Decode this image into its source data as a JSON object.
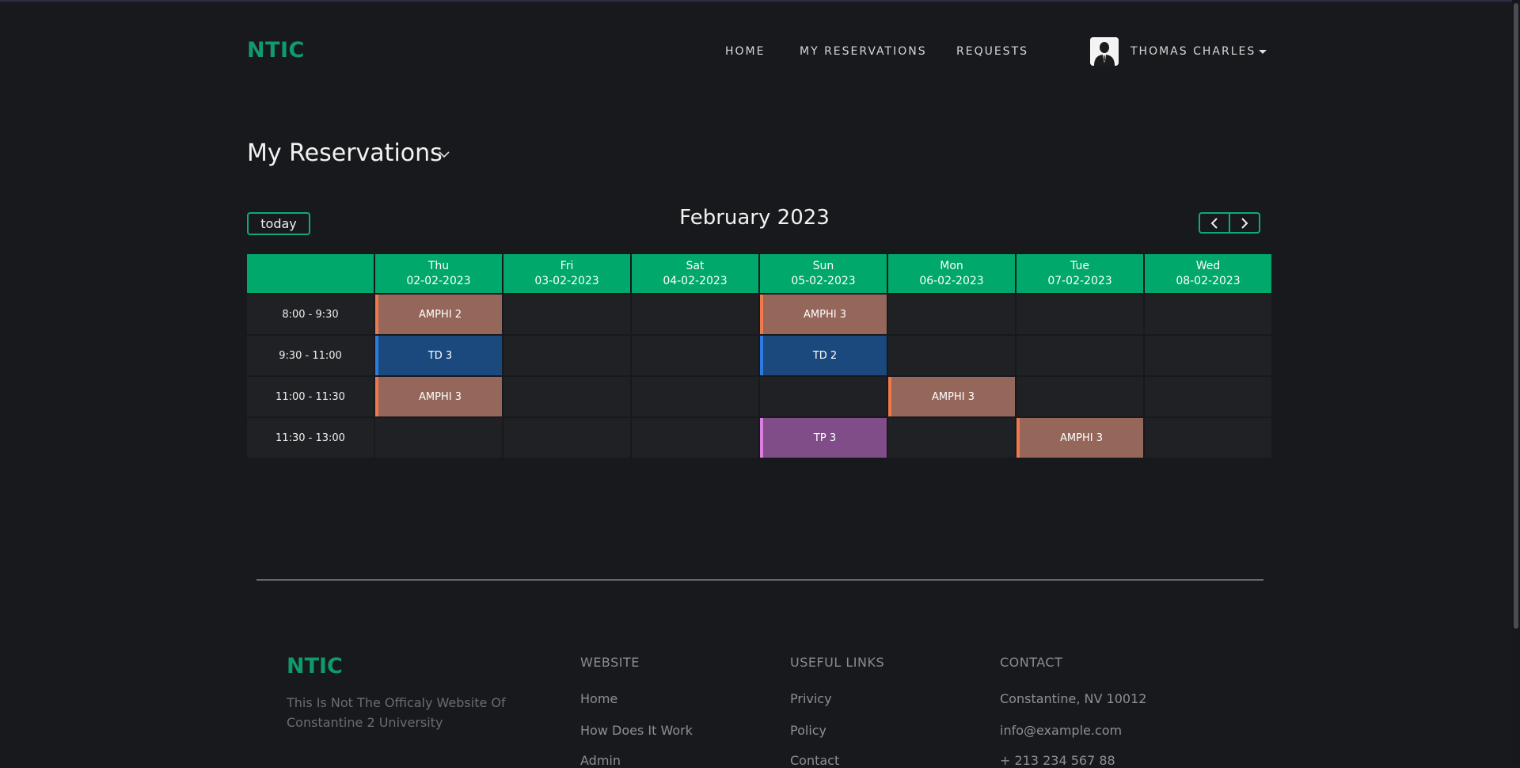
{
  "header": {
    "logo": "NTIC",
    "nav": [
      "HOME",
      "MY RESERVATIONS",
      "REQUESTS"
    ],
    "user_name": "THOMAS CHARLES"
  },
  "page": {
    "title": "My Reservations"
  },
  "calendar": {
    "today_label": "today",
    "month_title": "February 2023",
    "days": [
      {
        "name": "Thu",
        "date": "02-02-2023"
      },
      {
        "name": "Fri",
        "date": "03-02-2023"
      },
      {
        "name": "Sat",
        "date": "04-02-2023"
      },
      {
        "name": "Sun",
        "date": "05-02-2023"
      },
      {
        "name": "Mon",
        "date": "06-02-2023"
      },
      {
        "name": "Tue",
        "date": "07-02-2023"
      },
      {
        "name": "Wed",
        "date": "08-02-2023"
      }
    ],
    "slots": [
      "8:00 - 9:30",
      "9:30 - 11:00",
      "11:00 - 11:30",
      "11:30 - 13:00"
    ],
    "events": [
      {
        "day": 0,
        "slot": 0,
        "label": "AMPHI 2",
        "kind": "amphi"
      },
      {
        "day": 3,
        "slot": 0,
        "label": "AMPHI 3",
        "kind": "amphi"
      },
      {
        "day": 0,
        "slot": 1,
        "label": "TD 3",
        "kind": "td"
      },
      {
        "day": 3,
        "slot": 1,
        "label": "TD 2",
        "kind": "td"
      },
      {
        "day": 0,
        "slot": 2,
        "label": "AMPHI 3",
        "kind": "amphi"
      },
      {
        "day": 4,
        "slot": 2,
        "label": "AMPHI 3",
        "kind": "amphi"
      },
      {
        "day": 3,
        "slot": 3,
        "label": "TP 3",
        "kind": "tp"
      },
      {
        "day": 5,
        "slot": 3,
        "label": "AMPHI 3",
        "kind": "amphi"
      }
    ]
  },
  "footer": {
    "logo": "NTIC",
    "description": "This Is Not The Officaly Website Of Constantine 2 University",
    "columns": [
      {
        "heading": "WEBSITE",
        "links": [
          "Home",
          "How Does It Work",
          "Admin"
        ]
      },
      {
        "heading": "USEFUL LINKS",
        "links": [
          "Privicy",
          "Policy",
          "Contact"
        ]
      },
      {
        "heading": "CONTACT",
        "links": [
          "Constantine, NV 10012",
          "info@example.com",
          "+ 213 234 567 88"
        ]
      }
    ]
  },
  "colors": {
    "brand_green": "#00a86b",
    "amphi": "#94675a",
    "td": "#1b497d",
    "tp": "#804d89"
  }
}
